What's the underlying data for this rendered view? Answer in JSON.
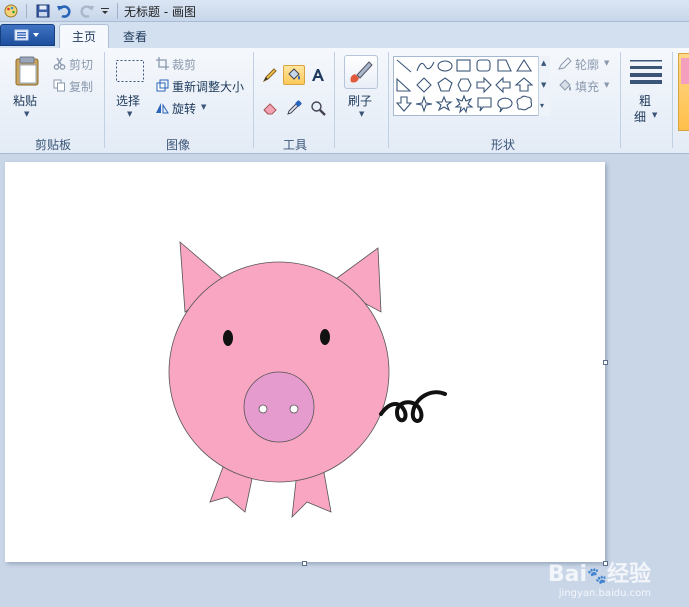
{
  "window": {
    "title": "无标题 - 画图"
  },
  "tabs": [
    {
      "label": "主页"
    },
    {
      "label": "查看"
    }
  ],
  "clipboard": {
    "paste": "粘贴",
    "cut": "剪切",
    "copy": "复制",
    "label": "剪贴板"
  },
  "image": {
    "select": "选择",
    "crop": "裁剪",
    "resize": "重新调整大小",
    "rotate": "旋转",
    "label": "图像"
  },
  "tools": {
    "label": "工具"
  },
  "brushes": {
    "label": "刷子"
  },
  "shapes": {
    "outline": "轮廓",
    "fill": "填充",
    "label": "形状"
  },
  "size": {
    "label_top": "粗",
    "label_bottom": "细"
  },
  "watermark": {
    "brand": "Bai",
    "brand2": "经验",
    "sub": "jingyan.baidu.com"
  },
  "icons": [
    "paint-app-icon",
    "save-icon",
    "undo-icon",
    "redo-icon",
    "qa-dropdown-icon",
    "paste-icon",
    "cut-icon",
    "copy-icon",
    "select-icon",
    "crop-icon",
    "resize-icon",
    "rotate-icon",
    "pencil-icon",
    "fill-icon",
    "text-icon",
    "eraser-icon",
    "color-picker-icon",
    "magnifier-icon",
    "brush-icon",
    "size-icon"
  ],
  "colors": {
    "pig_pink": "#f9a6c3",
    "snout_pink": "#e59bcd",
    "ribbon_bg": "#f5f8fc",
    "canvas_bg": "#ffffff",
    "workspace_bg": "#c9d6e8"
  }
}
